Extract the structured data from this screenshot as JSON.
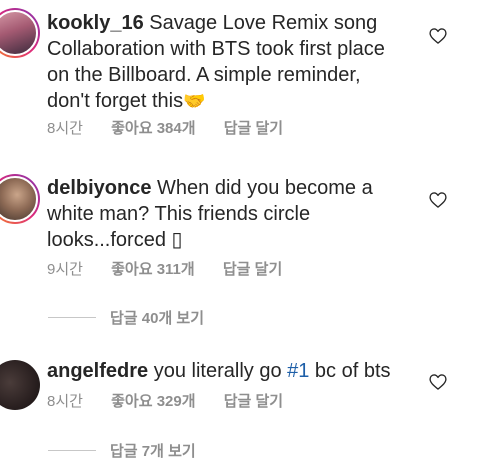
{
  "comments": [
    {
      "username": "kookly_16",
      "text": "Savage Love Remix song Collaboration with BTS took first place on the Billboard. A simple reminder, don't forget this",
      "emoji": "🤝",
      "time": "8시간",
      "likes": "좋아요 384개",
      "reply": "답글 달기",
      "avatar_colors": [
        "#c77b8e",
        "#5b3a55"
      ]
    },
    {
      "username": "delbiyonce",
      "text": "When did you become a white man? This friends circle looks...forced",
      "emoji": "▯",
      "time": "9시간",
      "likes": "좋아요 311개",
      "reply": "답글 달기",
      "avatar_colors": [
        "#b89478",
        "#4a3a30"
      ]
    },
    {
      "username": "angelfedre",
      "text_before": "you literally go ",
      "hashtag": "#1",
      "text_after": " bc of bts",
      "time": "8시간",
      "likes": "좋아요 329개",
      "reply": "답글 달기",
      "avatar_colors": [
        "#3a3030",
        "#1a1414"
      ]
    }
  ],
  "view_replies": [
    "답글 40개 보기",
    "답글 7개 보기"
  ],
  "icons": {
    "like": "heart-outline-icon"
  },
  "colors": {
    "text": "#262626",
    "meta": "#8e8e8e",
    "hashtag": "#1e5fa8"
  }
}
